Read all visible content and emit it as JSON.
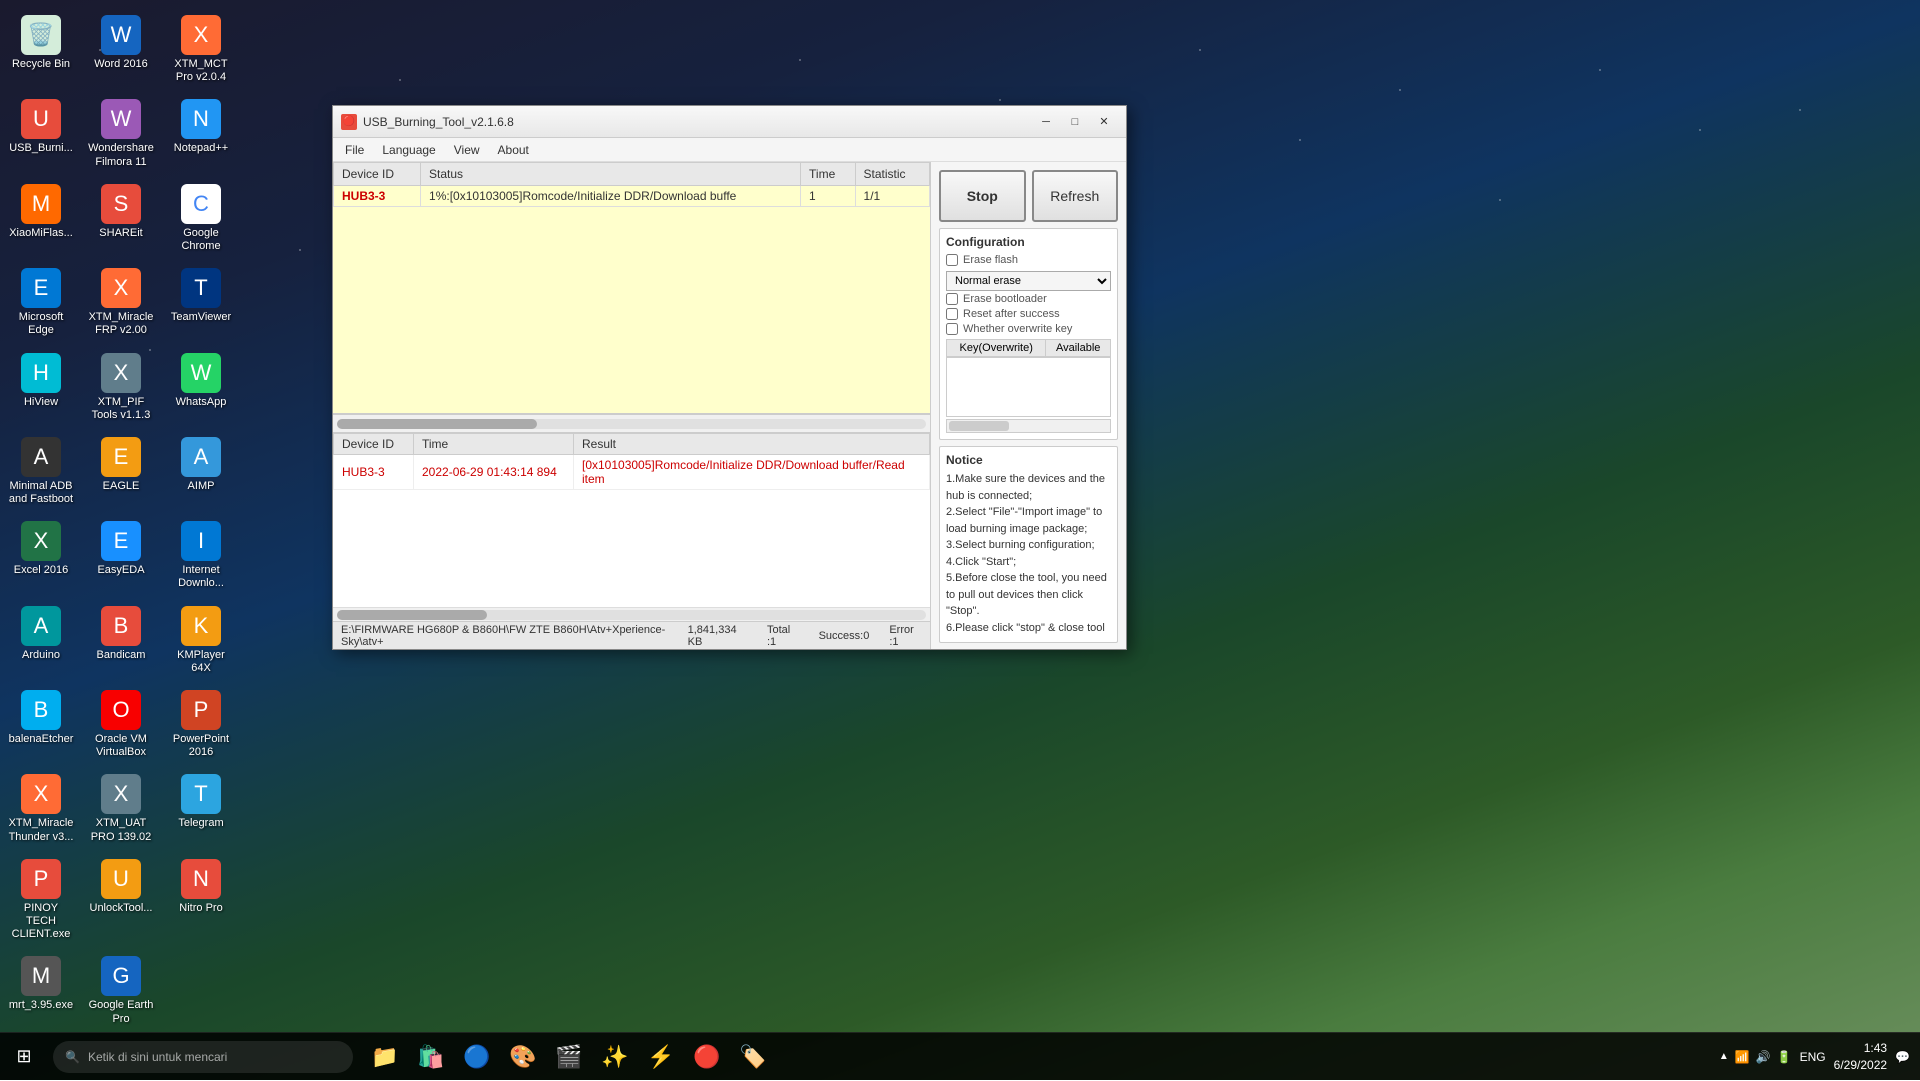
{
  "desktop": {
    "icons": [
      {
        "id": "recycle-bin",
        "label": "Recycle Bin",
        "icon": "🗑️",
        "color": "ic-recycle"
      },
      {
        "id": "word-2016",
        "label": "Word 2016",
        "icon": "W",
        "color": "ic-word"
      },
      {
        "id": "xtm-mct",
        "label": "XTM_MCT Pro v2.0.4",
        "icon": "X",
        "color": "ic-xtm"
      },
      {
        "id": "usb-burning",
        "label": "USB_Burni...",
        "icon": "U",
        "color": "ic-usb"
      },
      {
        "id": "wondershare",
        "label": "Wondershare Filmora 11",
        "icon": "W",
        "color": "ic-filmora"
      },
      {
        "id": "notepadpp",
        "label": "Notepad++",
        "icon": "N",
        "color": "ic-notepad"
      },
      {
        "id": "xiaomi",
        "label": "XiaoMiFlas...",
        "icon": "M",
        "color": "ic-xiaomi"
      },
      {
        "id": "shareit",
        "label": "SHAREit",
        "icon": "S",
        "color": "ic-shareit"
      },
      {
        "id": "google-chrome",
        "label": "Google Chrome",
        "icon": "C",
        "color": "ic-chrome"
      },
      {
        "id": "ms-edge",
        "label": "Microsoft Edge",
        "icon": "E",
        "color": "ic-edge"
      },
      {
        "id": "xtm-miracle",
        "label": "XTM_Miracle FRP v2.00",
        "icon": "X",
        "color": "ic-xtm"
      },
      {
        "id": "teamviewer",
        "label": "TeamViewer",
        "icon": "T",
        "color": "ic-teamviewer"
      },
      {
        "id": "hiview",
        "label": "HiView",
        "icon": "H",
        "color": "ic-hiview"
      },
      {
        "id": "xtm-pif",
        "label": "XTM_PIF Tools v1.1.3",
        "icon": "X",
        "color": "ic-pjtools"
      },
      {
        "id": "whatsapp",
        "label": "WhatsApp",
        "icon": "W",
        "color": "ic-whatsapp"
      },
      {
        "id": "minimal-adb",
        "label": "Minimal ADB and Fastboot",
        "icon": "A",
        "color": "ic-minadb"
      },
      {
        "id": "eagle",
        "label": "EAGLE",
        "icon": "E",
        "color": "ic-eagle"
      },
      {
        "id": "aimp",
        "label": "AIMP",
        "icon": "A",
        "color": "ic-aimp"
      },
      {
        "id": "excel-2016",
        "label": "Excel 2016",
        "icon": "X",
        "color": "ic-excel"
      },
      {
        "id": "easyeda",
        "label": "EasyEDA",
        "icon": "E",
        "color": "ic-easyeda"
      },
      {
        "id": "internet-download",
        "label": "Internet Downlo...",
        "icon": "I",
        "color": "ic-internet"
      },
      {
        "id": "arduino",
        "label": "Arduino",
        "icon": "A",
        "color": "ic-arduino"
      },
      {
        "id": "bandicam",
        "label": "Bandicam",
        "icon": "B",
        "color": "ic-bandicam"
      },
      {
        "id": "kmplayer",
        "label": "KMPlayer 64X",
        "icon": "K",
        "color": "ic-kmplayer"
      },
      {
        "id": "balena",
        "label": "balenaEtcher",
        "icon": "B",
        "color": "ic-balena"
      },
      {
        "id": "oracle-vm",
        "label": "Oracle VM VirtualBox",
        "icon": "O",
        "color": "ic-oracle"
      },
      {
        "id": "powerpoint",
        "label": "PowerPoint 2016",
        "icon": "P",
        "color": "ic-ppt"
      },
      {
        "id": "xtm-thunder",
        "label": "XTM_Miracle Thunder v3...",
        "icon": "X",
        "color": "ic-thunder"
      },
      {
        "id": "xtm-uat",
        "label": "XTM_UAT PRO 139.02",
        "icon": "X",
        "color": "ic-uatpro"
      },
      {
        "id": "telegram",
        "label": "Telegram",
        "icon": "T",
        "color": "ic-telegram"
      },
      {
        "id": "pinoy",
        "label": "PINOY TECH CLIENT.exe",
        "icon": "P",
        "color": "ic-pinoy"
      },
      {
        "id": "unlock",
        "label": "UnlockTool...",
        "icon": "U",
        "color": "ic-unlock"
      },
      {
        "id": "nitro",
        "label": "Nitro Pro",
        "icon": "N",
        "color": "ic-nitro"
      },
      {
        "id": "mrt",
        "label": "mrt_3.95.exe",
        "icon": "M",
        "color": "ic-mrt"
      },
      {
        "id": "google-earth",
        "label": "Google Earth Pro",
        "icon": "G",
        "color": "ic-googleearth"
      }
    ]
  },
  "window": {
    "title": "USB_Burning_Tool_v2.1.6.8",
    "title_icon": "🔴",
    "menu": [
      "File",
      "Language",
      "View",
      "About"
    ]
  },
  "buttons": {
    "stop": "Stop",
    "refresh": "Refresh"
  },
  "table": {
    "headers": [
      "Device ID",
      "Status",
      "Time",
      "Statistic"
    ],
    "rows": [
      {
        "device_id": "HUB3-3",
        "status": "1%:[0x10103005]Romcode/Initialize DDR/Download buffe",
        "time": "1",
        "statistic": "1/1"
      }
    ]
  },
  "log_table": {
    "headers": [
      "Device ID",
      "Time",
      "Result"
    ],
    "rows": [
      {
        "device_id": "HUB3-3",
        "time": "2022-06-29 01:43:14 894",
        "result": "[0x10103005]Romcode/Initialize DDR/Download buffer/Read item"
      }
    ]
  },
  "config": {
    "title": "Configuration",
    "erase_flash": "Erase flash",
    "normal_erase": "Normal erase",
    "erase_bootloader": "Erase bootloader",
    "reset_after_success": "Reset after success",
    "whether_overwrite": "Whether overwrite key"
  },
  "key_table": {
    "headers": [
      "Key(Overwrite)",
      "Available"
    ]
  },
  "notice": {
    "title": "Notice",
    "items": [
      "1.Make sure the devices and the hub is connected;",
      "2.Select \"File\"-\"Import image\" to load burning image package;",
      "3.Select burning configuration;",
      "4.Click \"Start\";",
      "5.Before close the tool, you need to pull out devices then click \"Stop\".",
      "6.Please click \"stop\" & close tool"
    ]
  },
  "status_bar": {
    "path": "E:\\FIRMWARE HG680P & B860H\\FW ZTE B860H\\Atv+Xperience-Sky\\atv+",
    "file_size": "1,841,334 KB",
    "total": "Total :1",
    "success": "Success:0",
    "error": "Error :1"
  },
  "taskbar": {
    "search_placeholder": "Ketik di sini untuk mencari",
    "time": "1:43",
    "date": "6/29/2022",
    "lang": "ENG"
  }
}
